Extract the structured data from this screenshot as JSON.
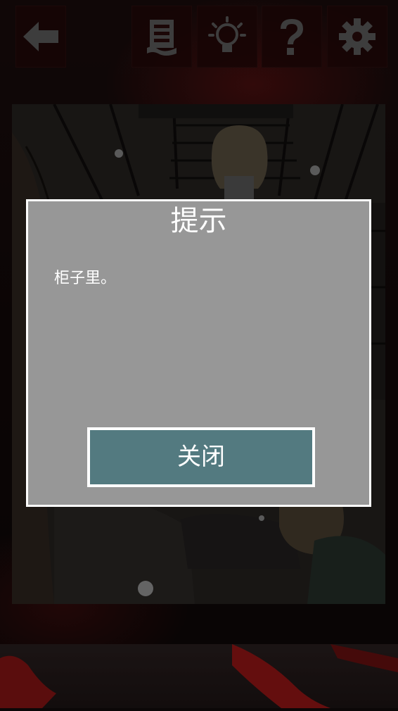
{
  "toolbar": {
    "icons": [
      "back-arrow-icon",
      "scroll-icon",
      "lightbulb-icon",
      "question-mark-icon",
      "gear-icon"
    ]
  },
  "dialog": {
    "title": "提示",
    "message": "柜子里。",
    "close_label": "关闭"
  },
  "colors": {
    "dialog_bg": "#979797",
    "dialog_border": "#ffffff",
    "close_button_bg": "#537a80",
    "accent_red": "#8a1414"
  }
}
